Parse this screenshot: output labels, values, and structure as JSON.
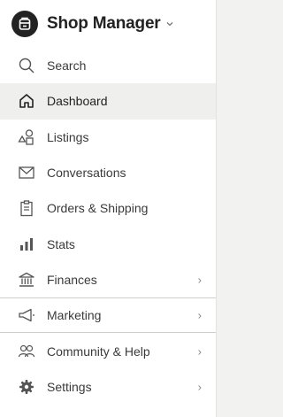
{
  "app": {
    "title": "Shop Manager"
  },
  "nav": {
    "search": "Search",
    "dashboard": "Dashboard",
    "listings": "Listings",
    "conversations": "Conversations",
    "orders": "Orders & Shipping",
    "stats": "Stats",
    "finances": "Finances",
    "marketing": "Marketing",
    "community": "Community & Help",
    "settings": "Settings"
  },
  "chevron": "›"
}
